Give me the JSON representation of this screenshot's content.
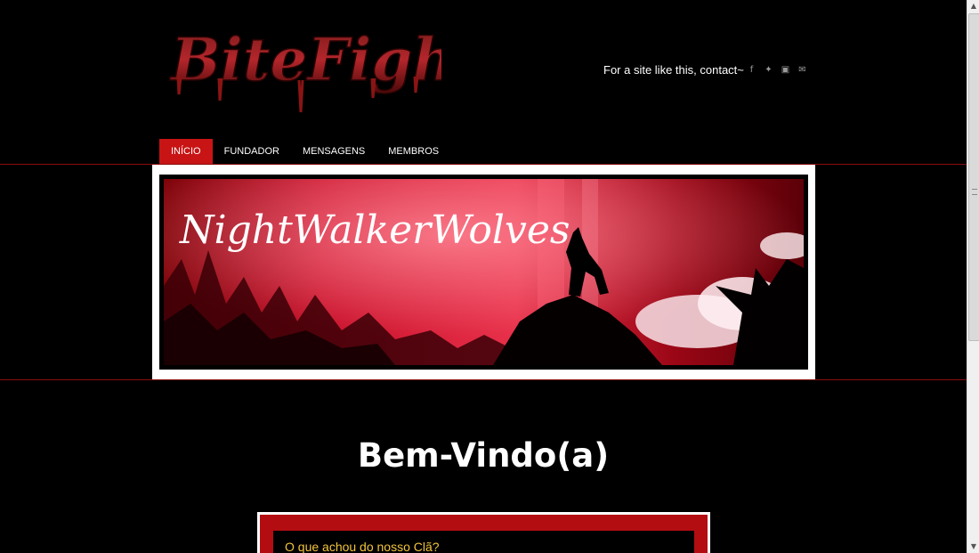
{
  "header": {
    "logo_text": "BiteFight",
    "contact_text": "For a site like this, contact~",
    "social_icons": [
      "facebook-icon",
      "twitter-icon",
      "youtube-icon",
      "mail-icon"
    ]
  },
  "nav": {
    "items": [
      {
        "label": "INÍCIO",
        "active": true
      },
      {
        "label": "FUNDADOR",
        "active": false
      },
      {
        "label": "MENSAGENS",
        "active": false
      },
      {
        "label": "MEMBROS",
        "active": false
      }
    ]
  },
  "banner": {
    "title": "NightWalkerWolves"
  },
  "main": {
    "heading": "Bem-Vindo(a)",
    "poll_question": "O que achou do nosso Clã?"
  },
  "colors": {
    "accent": "#c81414",
    "poll_text": "#f2c43a"
  }
}
